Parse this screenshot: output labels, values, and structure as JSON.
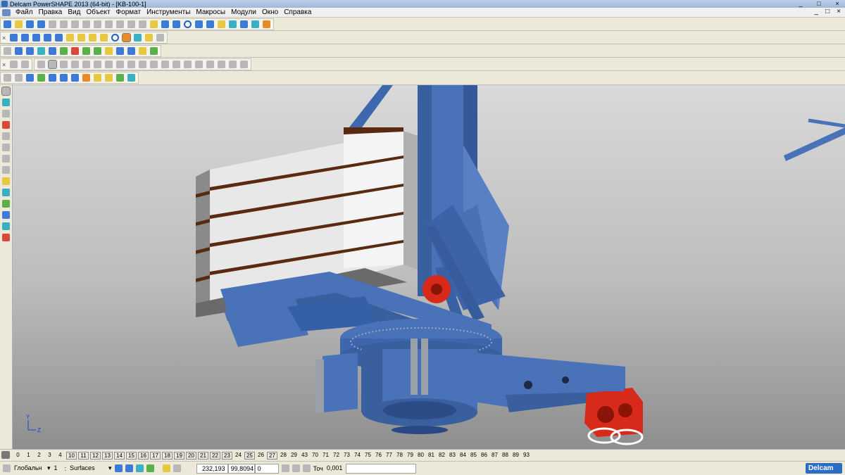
{
  "window": {
    "title": "Delcam PowerSHAPE 2013 (64-bit) - [KB-100-1]",
    "controls": [
      "_",
      "□",
      "×"
    ]
  },
  "menu": {
    "items": [
      "Файл",
      "Правка",
      "Вид",
      "Объект",
      "Формат",
      "Инструменты",
      "Макросы",
      "Модули",
      "Окно",
      "Справка"
    ],
    "mdi_controls": [
      "_",
      "□",
      "×"
    ]
  },
  "levels": [
    "0",
    "1",
    "2",
    "3",
    "4",
    "10",
    "11",
    "12",
    "13",
    "14",
    "15",
    "16",
    "17",
    "18",
    "19",
    "20",
    "21",
    "22",
    "23",
    "24",
    "25",
    "26",
    "27",
    "28",
    "29",
    "43",
    "70",
    "71",
    "72",
    "73",
    "74",
    "75",
    "76",
    "77",
    "78",
    "79",
    "80",
    "81",
    "82",
    "83",
    "84",
    "85",
    "86",
    "87",
    "88",
    "89",
    "93"
  ],
  "status": {
    "workplane": "Глобальн",
    "level_number": "1",
    "level_name": "Surfaces",
    "coord_x": "232,193",
    "coord_y": "99,8094",
    "coord_z": "0",
    "tolerance_label": "Точ",
    "tolerance_value": "0,001",
    "brand": "Delcam"
  },
  "axes": {
    "y": "Y",
    "z": "Z"
  },
  "colors": {
    "model_blue": "#4a72b8",
    "red_part": "#d82a1a",
    "viewport_top": "#d9d9d9",
    "viewport_bottom": "#8e8e8e"
  }
}
